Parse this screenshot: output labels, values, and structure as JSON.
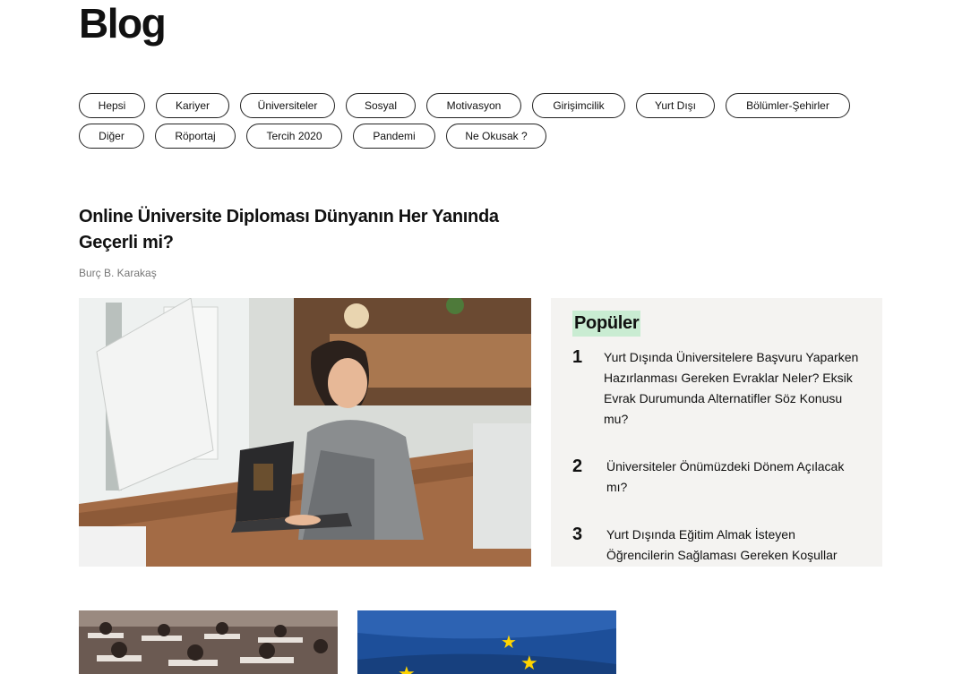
{
  "header": {
    "title": "Blog"
  },
  "tags": {
    "row1": [
      "Hepsi",
      "Kariyer",
      "Üniversiteler",
      "Sosyal",
      "Motivasyon",
      "Girişimcilik",
      "Yurt Dışı",
      "Bölümler-Şehirler"
    ],
    "row2": [
      "Diğer",
      "Röportaj",
      "Tercih 2020",
      "Pandemi",
      "Ne Okusak ?"
    ]
  },
  "featured": {
    "title": "Online Üniversite Diploması Dünyanın Her Yanında Geçerli mi?",
    "author": "Burç B. Karakaş"
  },
  "popular": {
    "heading": "Popüler",
    "items": [
      {
        "num": "1",
        "text": "Yurt Dışında Üniversitelere Başvuru Yaparken Hazırlanması Gereken Evraklar Neler? Eksik Evrak Durumunda Alternatifler Söz Konusu mu?"
      },
      {
        "num": "2",
        "text": "Üniversiteler Önümüzdeki Dönem Açılacak mı?"
      },
      {
        "num": "3",
        "text": "Yurt Dışında Eğitim Almak İsteyen Öğrencilerin Sağlaması Gereken Koşullar"
      }
    ]
  },
  "colors": {
    "highlight": "#c9ecd2",
    "panel": "#f4f3f1",
    "eu_blue": "#1d4f9a",
    "eu_star": "#ffd400"
  }
}
